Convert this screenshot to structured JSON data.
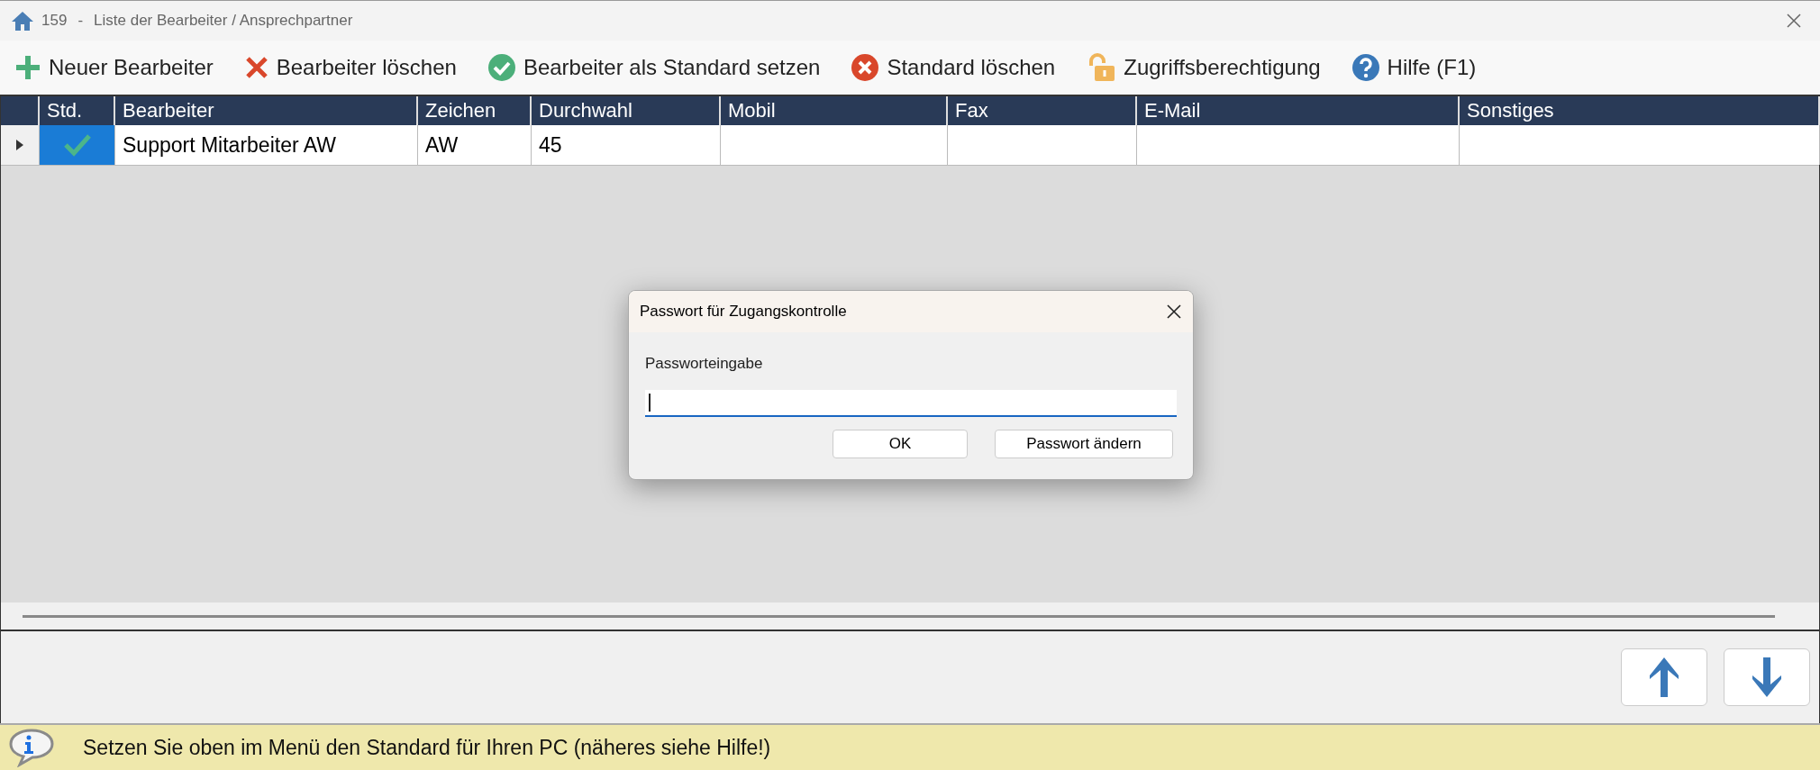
{
  "window": {
    "number": "159",
    "separator": "-",
    "title": "Liste der Bearbeiter / Ansprechpartner"
  },
  "toolbar": [
    {
      "kind": "add",
      "label": "Neuer Bearbeiter"
    },
    {
      "kind": "delete",
      "label": "Bearbeiter löschen"
    },
    {
      "kind": "set-default",
      "label": "Bearbeiter als Standard setzen"
    },
    {
      "kind": "clear-default",
      "label": "Standard löschen"
    },
    {
      "kind": "access",
      "label": "Zugriffsberechtigung"
    },
    {
      "kind": "help",
      "label": "Hilfe (F1)"
    }
  ],
  "table": {
    "columns": [
      "Std.",
      "Bearbeiter",
      "Zeichen",
      "Durchwahl",
      "Mobil",
      "Fax",
      "E-Mail",
      "Sonstiges"
    ],
    "rows": [
      {
        "current": true,
        "default": true,
        "cells": [
          "",
          "Support Mitarbeiter AW",
          "AW",
          "45",
          "",
          "",
          "",
          ""
        ]
      }
    ]
  },
  "nav_buttons": [
    {
      "kind": "up"
    },
    {
      "kind": "down"
    }
  ],
  "dialog": {
    "title": "Passwort für Zugangskontrolle",
    "label": "Passworteingabe",
    "focused": true,
    "buttons": [
      "OK",
      "Passwort ändern"
    ]
  },
  "status_bar": {
    "message": "Setzen Sie oben im Menü den Standard für Ihren PC (näheres siehe Hilfe!)"
  }
}
